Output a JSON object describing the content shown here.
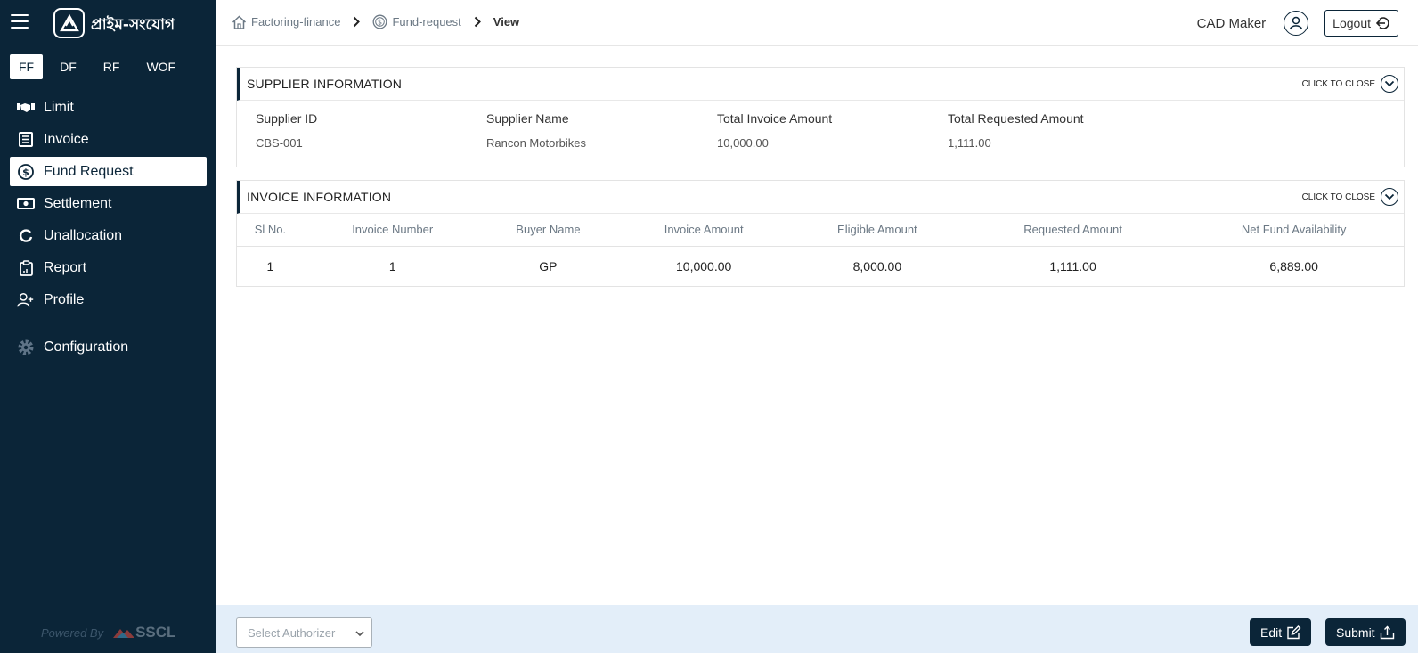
{
  "brand": {
    "name": "প্রাইম-সংযোগ"
  },
  "product_tabs": [
    {
      "label": "FF",
      "active": true
    },
    {
      "label": "DF",
      "active": false
    },
    {
      "label": "RF",
      "active": false
    },
    {
      "label": "WOF",
      "active": false
    }
  ],
  "nav": {
    "items": [
      {
        "label": "Limit",
        "icon": "handshake-icon"
      },
      {
        "label": "Invoice",
        "icon": "document-list-icon"
      },
      {
        "label": "Fund Request",
        "icon": "dollar-circle-icon",
        "active": true
      },
      {
        "label": "Settlement",
        "icon": "banknote-icon"
      },
      {
        "label": "Unallocation",
        "icon": "circle-arrow-icon"
      },
      {
        "label": "Report",
        "icon": "clipboard-icon"
      },
      {
        "label": "Profile",
        "icon": "user-plus-icon"
      },
      {
        "label": "Configuration",
        "icon": "gear-icon"
      }
    ]
  },
  "footer": {
    "powered_by": "Powered By",
    "company": "SSCL"
  },
  "breadcrumb": {
    "items": [
      "Factoring-finance",
      "Fund-request",
      "View"
    ]
  },
  "user": {
    "name": "CAD Maker",
    "logout_label": "Logout"
  },
  "supplier_panel": {
    "title": "SUPPLIER INFORMATION",
    "close_label": "CLICK TO CLOSE",
    "fields": [
      {
        "label": "Supplier ID",
        "value": "CBS-001"
      },
      {
        "label": "Supplier Name",
        "value": "Rancon Motorbikes"
      },
      {
        "label": "Total Invoice Amount",
        "value": "10,000.00"
      },
      {
        "label": "Total Requested Amount",
        "value": "1,111.00"
      }
    ]
  },
  "invoice_panel": {
    "title": "INVOICE INFORMATION",
    "close_label": "CLICK TO CLOSE",
    "columns": [
      "Sl No.",
      "Invoice Number",
      "Buyer Name",
      "Invoice Amount",
      "Eligible Amount",
      "Requested Amount",
      "Net Fund Availability"
    ],
    "rows": [
      [
        "1",
        "1",
        "GP",
        "10,000.00",
        "8,000.00",
        "1,111.00",
        "6,889.00"
      ]
    ]
  },
  "bottom_bar": {
    "authorizer_placeholder": "Select Authorizer",
    "edit_label": "Edit",
    "submit_label": "Submit"
  },
  "colors": {
    "sidebar": "#0b2538",
    "bottom_bar": "#e3eef9",
    "accent": "#0b2538"
  }
}
